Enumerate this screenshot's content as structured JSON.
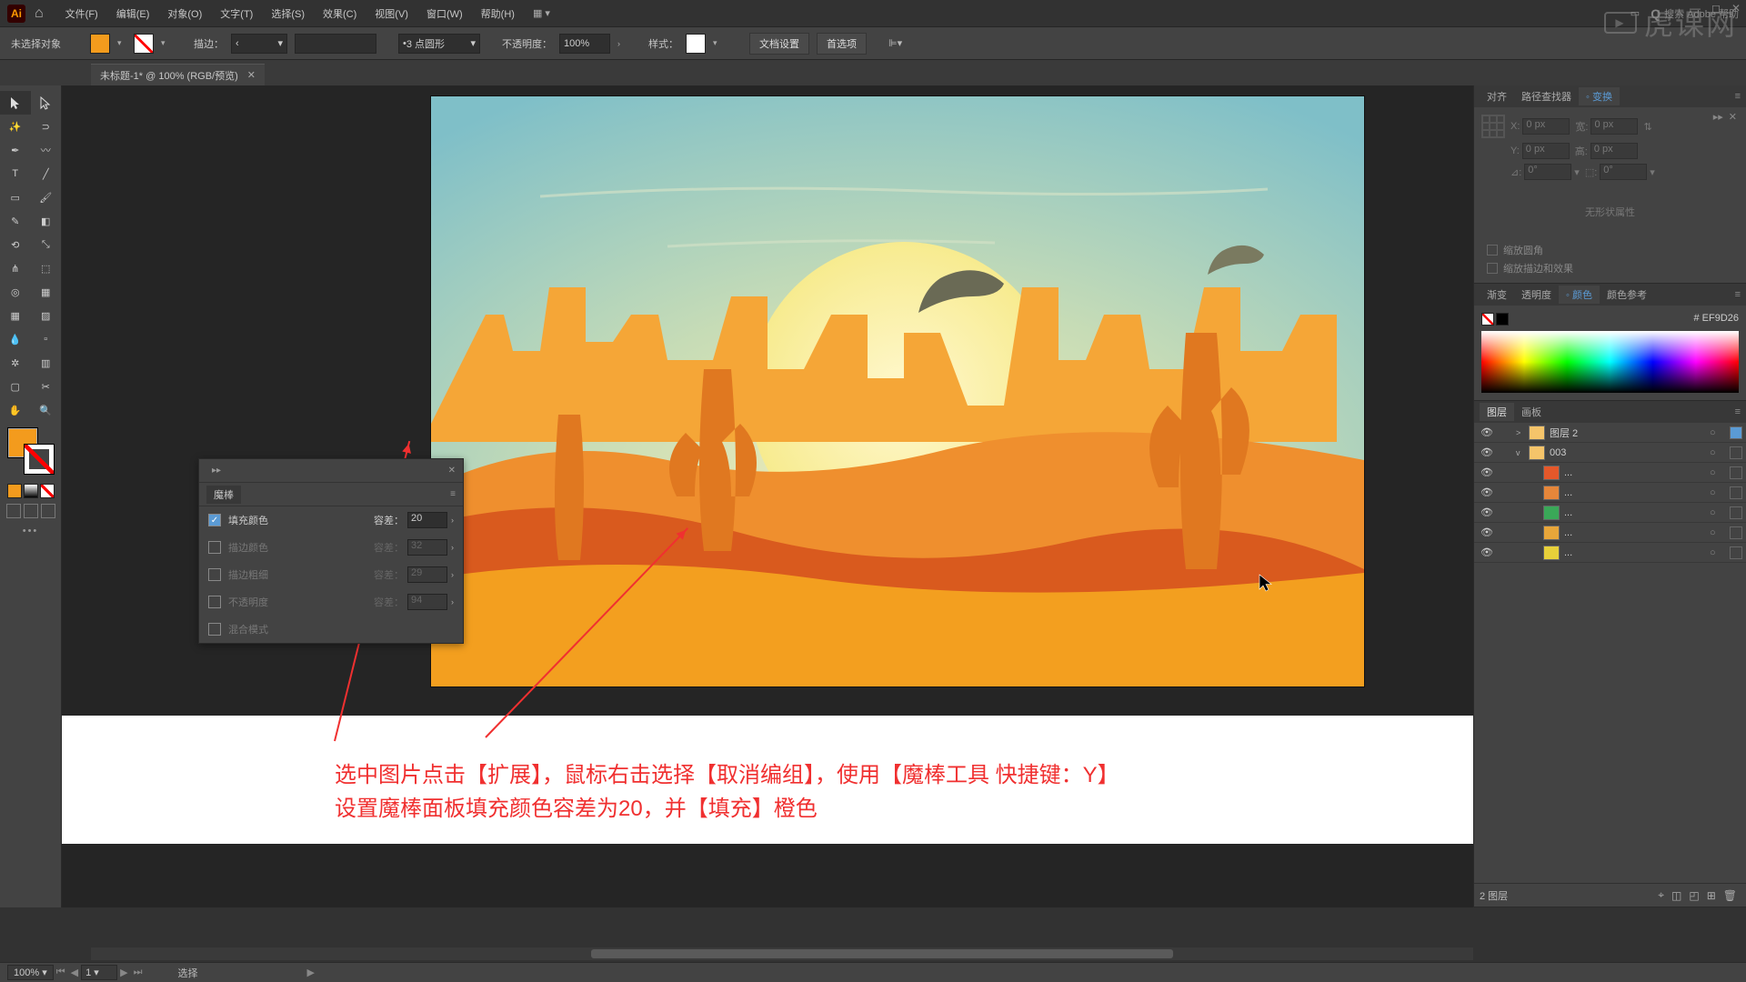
{
  "app": {
    "logo": "Ai"
  },
  "menubar": {
    "items": [
      "文件(F)",
      "编辑(E)",
      "对象(O)",
      "文字(T)",
      "选择(S)",
      "效果(C)",
      "视图(V)",
      "窗口(W)",
      "帮助(H)"
    ],
    "search_placeholder": "搜索 Adobe 帮助"
  },
  "control": {
    "no_selection": "未选择对象",
    "stroke_label": "描边：",
    "stroke_value": "",
    "profile_label": "3 点圆形",
    "opacity_label": "不透明度：",
    "opacity_value": "100%",
    "style_label": "样式：",
    "doc_setup": "文档设置",
    "prefs": "首选项"
  },
  "doc_tab": {
    "title": "未标题-1* @ 100% (RGB/预览)"
  },
  "magic_wand": {
    "title": "魔棒",
    "options": [
      {
        "label": "填充颜色",
        "checked": true,
        "param": "容差：",
        "value": "20",
        "enabled": true
      },
      {
        "label": "描边颜色",
        "checked": false,
        "param": "容差：",
        "value": "32",
        "enabled": false
      },
      {
        "label": "描边粗细",
        "checked": false,
        "param": "容差：",
        "value": "29",
        "enabled": false
      },
      {
        "label": "不透明度",
        "checked": false,
        "param": "容差：",
        "value": "94",
        "enabled": false
      },
      {
        "label": "混合模式",
        "checked": false,
        "param": "",
        "value": "",
        "enabled": false
      }
    ]
  },
  "instruction": {
    "line1": "选中图片点击【扩展】，鼠标右击选择【取消编组】，使用【魔棒工具 快捷键：Y】",
    "line2": "设置魔棒面板填充颜色容差为20，并【填充】橙色"
  },
  "panels": {
    "align_tab": "对齐",
    "pathfinder_tab": "路径查找器",
    "transform_tab": "变换",
    "tf": {
      "x": "X:",
      "xv": "0 px",
      "y": "Y:",
      "yv": "0 px",
      "w": "宽:",
      "wv": "0 px",
      "h": "高:",
      "hv": "0 px",
      "angle": "⊿:",
      "av": "0°",
      "shear": "⬚:",
      "sv": "0°"
    },
    "no_shape": "无形状属性",
    "scale_corners": "缩放圆角",
    "scale_stroke": "缩放描边和效果",
    "gradient_tab": "渐变",
    "transparency_tab": "透明度",
    "color_tab": "颜色",
    "swatch_tab": "颜色参考",
    "hex_prefix": "#",
    "hex_value": "EF9D26",
    "layers_tab": "图层",
    "artboards_tab": "画板",
    "layers_count": "2 图层"
  },
  "layers": [
    {
      "indent": 0,
      "toggle": ">",
      "name": "图层 2",
      "thumb": "#f5c46a",
      "sel": true
    },
    {
      "indent": 0,
      "toggle": "v",
      "name": "003",
      "thumb": "#f5c46a"
    },
    {
      "indent": 1,
      "toggle": "",
      "name": "...",
      "thumb": "#e5582a"
    },
    {
      "indent": 1,
      "toggle": "",
      "name": "...",
      "thumb": "#e5863a"
    },
    {
      "indent": 1,
      "toggle": "",
      "name": "...",
      "thumb": "#3aa858"
    },
    {
      "indent": 1,
      "toggle": "",
      "name": "...",
      "thumb": "#e8a63a"
    },
    {
      "indent": 1,
      "toggle": "",
      "name": "...",
      "thumb": "#e8d03a"
    }
  ],
  "status": {
    "zoom": "100%",
    "artboard": "1",
    "tool": "选择"
  },
  "watermark": "虎课网"
}
